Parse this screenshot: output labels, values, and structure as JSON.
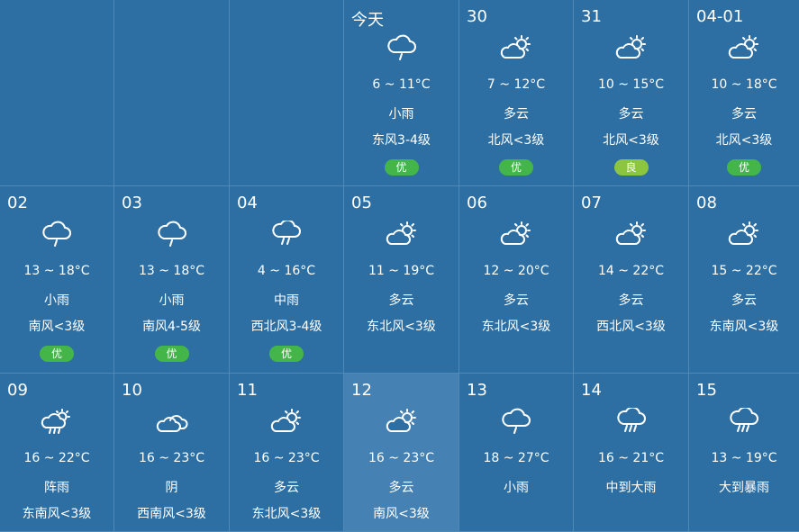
{
  "calendar": {
    "cells": [
      {
        "day": "",
        "temp": "",
        "cond": "",
        "wind": "",
        "aqi": "",
        "icon": ""
      },
      {
        "day": "",
        "temp": "",
        "cond": "",
        "wind": "",
        "aqi": "",
        "icon": ""
      },
      {
        "day": "",
        "temp": "",
        "cond": "",
        "wind": "",
        "aqi": "",
        "icon": ""
      },
      {
        "day": "今天",
        "temp": "6 ~ 11°C",
        "cond": "小雨",
        "wind": "东风3-4级",
        "aqi": "优",
        "icon": "light-rain-icon"
      },
      {
        "day": "30",
        "temp": "7 ~ 12°C",
        "cond": "多云",
        "wind": "北风<3级",
        "aqi": "优",
        "icon": "partly-cloudy-icon"
      },
      {
        "day": "31",
        "temp": "10 ~ 15°C",
        "cond": "多云",
        "wind": "北风<3级",
        "aqi": "良",
        "icon": "partly-cloudy-icon"
      },
      {
        "day": "04-01",
        "temp": "10 ~ 18°C",
        "cond": "多云",
        "wind": "北风<3级",
        "aqi": "优",
        "icon": "partly-cloudy-icon"
      },
      {
        "day": "02",
        "temp": "13 ~ 18°C",
        "cond": "小雨",
        "wind": "南风<3级",
        "aqi": "优",
        "icon": "light-rain-icon"
      },
      {
        "day": "03",
        "temp": "13 ~ 18°C",
        "cond": "小雨",
        "wind": "南风4-5级",
        "aqi": "优",
        "icon": "light-rain-icon"
      },
      {
        "day": "04",
        "temp": "4 ~ 16°C",
        "cond": "中雨",
        "wind": "西北风3-4级",
        "aqi": "优",
        "icon": "moderate-rain-icon"
      },
      {
        "day": "05",
        "temp": "11 ~ 19°C",
        "cond": "多云",
        "wind": "东北风<3级",
        "aqi": "",
        "icon": "partly-cloudy-icon"
      },
      {
        "day": "06",
        "temp": "12 ~ 20°C",
        "cond": "多云",
        "wind": "东北风<3级",
        "aqi": "",
        "icon": "partly-cloudy-icon"
      },
      {
        "day": "07",
        "temp": "14 ~ 22°C",
        "cond": "多云",
        "wind": "西北风<3级",
        "aqi": "",
        "icon": "partly-cloudy-icon"
      },
      {
        "day": "08",
        "temp": "15 ~ 22°C",
        "cond": "多云",
        "wind": "东南风<3级",
        "aqi": "",
        "icon": "partly-cloudy-icon"
      },
      {
        "day": "09",
        "temp": "16 ~ 22°C",
        "cond": "阵雨",
        "wind": "东南风<3级",
        "aqi": "",
        "icon": "shower-icon"
      },
      {
        "day": "10",
        "temp": "16 ~ 23°C",
        "cond": "阴",
        "wind": "西南风<3级",
        "aqi": "",
        "icon": "overcast-icon"
      },
      {
        "day": "11",
        "temp": "16 ~ 23°C",
        "cond": "多云",
        "wind": "东北风<3级",
        "aqi": "",
        "icon": "partly-cloudy-icon"
      },
      {
        "day": "12",
        "temp": "16 ~ 23°C",
        "cond": "多云",
        "wind": "南风<3级",
        "aqi": "",
        "icon": "partly-cloudy-icon",
        "highlight": true
      },
      {
        "day": "13",
        "temp": "18 ~ 27°C",
        "cond": "小雨",
        "wind": "",
        "aqi": "",
        "icon": "light-rain-icon"
      },
      {
        "day": "14",
        "temp": "16 ~ 21°C",
        "cond": "中到大雨",
        "wind": "",
        "aqi": "",
        "icon": "heavy-rain-icon"
      },
      {
        "day": "15",
        "temp": "13 ~ 19°C",
        "cond": "大到暴雨",
        "wind": "",
        "aqi": "",
        "icon": "heavy-rain-icon"
      }
    ]
  },
  "colors": {
    "background": "#2d6fa3",
    "highlight": "#4581b2",
    "aqi_excellent": "#44b649",
    "aqi_good": "#8cc63f"
  }
}
